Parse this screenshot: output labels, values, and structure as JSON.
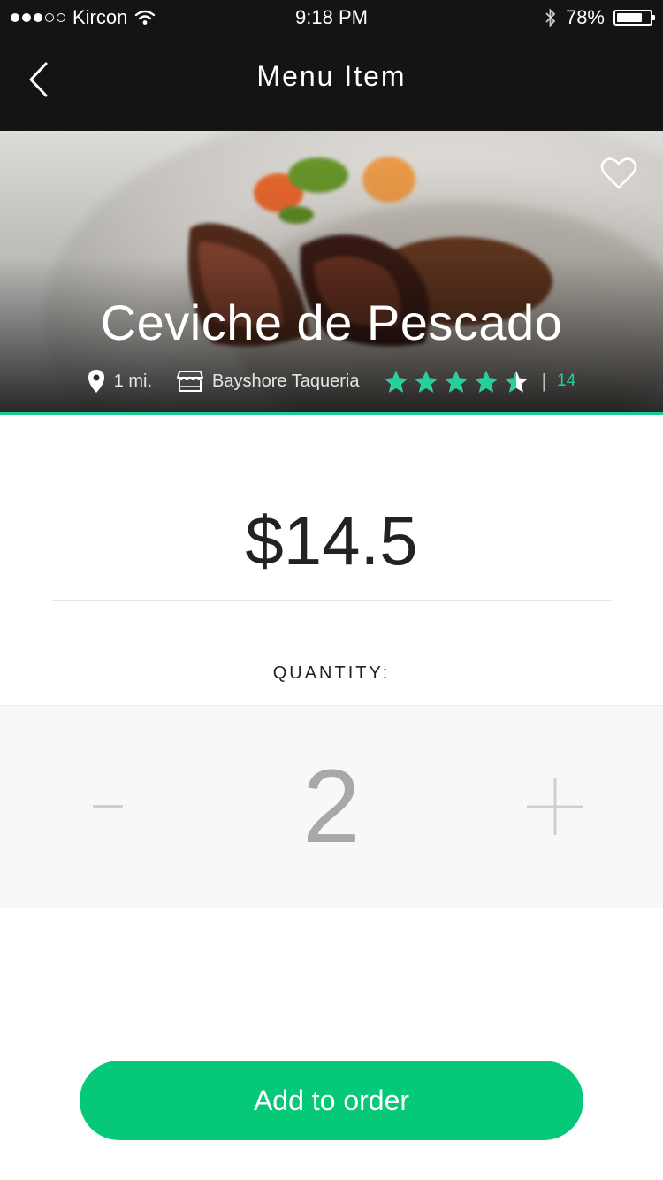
{
  "status_bar": {
    "carrier": "Kircon",
    "time": "9:18 PM",
    "battery": "78%",
    "battery_level": 0.78
  },
  "nav": {
    "title": "Menu Item",
    "back_icon": "chevron-left-icon"
  },
  "hero": {
    "dish_name": "Ceviche de Pescado",
    "distance": "1 mi.",
    "restaurant": "Bayshore Taqueria",
    "rating": 4.5,
    "rating_max": 5,
    "review_count": "14",
    "favorite_icon": "heart-outline-icon"
  },
  "price": "$14.5",
  "quantity": {
    "label": "QUANTITY:",
    "value": "2",
    "minus_icon": "minus-icon",
    "plus_icon": "plus-icon"
  },
  "add_button": "Add to order",
  "colors": {
    "accent": "#1ecb96",
    "button": "#05c978",
    "star": "#22d19c",
    "dark": "#141414"
  }
}
